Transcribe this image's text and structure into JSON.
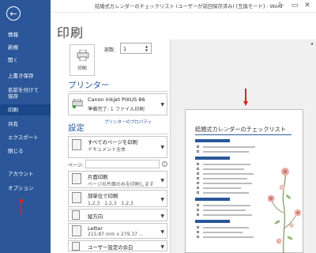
{
  "window": {
    "title": "結婚式カレンダーのチェックリスト (ユーザーが前回保存済み) [互換モード] - Word",
    "help": "?",
    "minimize": "–",
    "restore": "▭",
    "close": "✕"
  },
  "sidebar": {
    "back_icon": "←",
    "items": [
      {
        "label": "情報"
      },
      {
        "label": "新規"
      },
      {
        "label": "開く"
      },
      {
        "label": "上書き保存"
      },
      {
        "label": "名前を付けて"
      },
      {
        "label": "保存"
      },
      {
        "label": "印刷"
      },
      {
        "label": "共有"
      },
      {
        "label": "エクスポート"
      },
      {
        "label": "閉じる"
      },
      {
        "label": "アカウント"
      },
      {
        "label": "オプション"
      }
    ],
    "active": "印刷"
  },
  "main": {
    "heading": "印刷",
    "print_button": "印刷",
    "copies_label": "部数:",
    "copies_value": "1",
    "printer_heading": "プリンター",
    "printer_name": "Canon Inkjet PIXUS 86",
    "printer_status": "準備完了: 1 ファイル印刷",
    "printer_props": "プリンターのプロパティ",
    "settings_heading": "設定",
    "pages_label": "ページ:",
    "settings": [
      {
        "t1": "すべてのページを印刷",
        "t2": "ドキュメント全体"
      },
      {
        "t1": "片面印刷",
        "t2": "ページの片面のみを印刷します"
      },
      {
        "t1": "部単位で印刷",
        "t2": "1,2,3　1,2,3　1,2,3"
      },
      {
        "t1": "縦方向",
        "t2": ""
      },
      {
        "t1": "Letter",
        "t2": "215.87 mm x 279.37 ..."
      },
      {
        "t1": "ユーザー設定の余白",
        "t2": ""
      }
    ]
  },
  "preview": {
    "doc_title": "結婚式カレンダーのチェックリスト"
  },
  "colors": {
    "accent": "#2b579a",
    "arrow": "#d9241b"
  }
}
